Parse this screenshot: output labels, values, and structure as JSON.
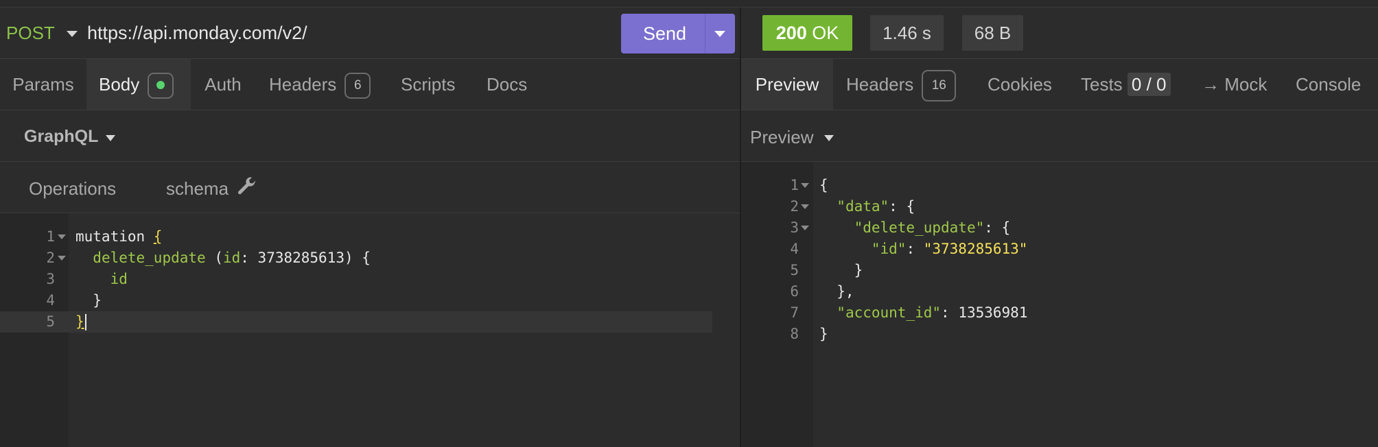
{
  "request": {
    "method": "POST",
    "url": "https://api.monday.com/v2/",
    "send_label": "Send"
  },
  "request_tabs": [
    {
      "label": "Params"
    },
    {
      "label": "Body"
    },
    {
      "label": "Auth"
    },
    {
      "label": "Headers",
      "badge": "6"
    },
    {
      "label": "Scripts"
    },
    {
      "label": "Docs"
    }
  ],
  "body_type": "GraphQL",
  "graphql_tabs": {
    "operations": "Operations",
    "schema": "schema"
  },
  "query_lines": [
    {
      "n": "1",
      "text": "mutation {"
    },
    {
      "n": "2",
      "text": "  delete_update (id: 3738285613) {"
    },
    {
      "n": "3",
      "text": "    id"
    },
    {
      "n": "4",
      "text": "  }"
    },
    {
      "n": "5",
      "text": "}"
    }
  ],
  "response": {
    "status_code": "200",
    "status_text": "OK",
    "time": "1.46 s",
    "size": "68 B",
    "status_color": "#73b532"
  },
  "response_tabs": [
    {
      "label": "Preview"
    },
    {
      "label": "Headers",
      "badge": "16"
    },
    {
      "label": "Cookies"
    },
    {
      "label": "Tests",
      "count": "0 / 0"
    },
    {
      "label": "→ Mock"
    },
    {
      "label": "Console"
    }
  ],
  "preview_mode": "Preview",
  "response_lines": [
    {
      "n": "1",
      "text": "{"
    },
    {
      "n": "2",
      "text": "  \"data\": {"
    },
    {
      "n": "3",
      "text": "    \"delete_update\": {"
    },
    {
      "n": "4",
      "text": "      \"id\": \"3738285613\""
    },
    {
      "n": "5",
      "text": "    }"
    },
    {
      "n": "6",
      "text": "  },"
    },
    {
      "n": "7",
      "text": "  \"account_id\": 13536981"
    },
    {
      "n": "8",
      "text": "}"
    }
  ],
  "icons": {
    "method_dropdown": "chevron-down-icon",
    "send_dropdown": "chevron-down-icon",
    "body_status": "green-dot-icon",
    "schema": "wrench-icon"
  },
  "accent_color": "#7b6fd0"
}
